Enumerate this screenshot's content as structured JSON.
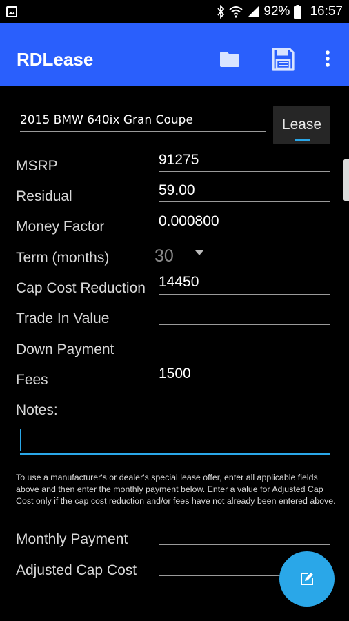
{
  "status_bar": {
    "battery": "92%",
    "time": "16:57",
    "icons": [
      "gallery-icon",
      "bluetooth-icon",
      "wifi-icon",
      "signal-icon",
      "battery-icon"
    ]
  },
  "app_bar": {
    "title": "RDLease",
    "color": "#2a5ffc",
    "actions": [
      "folder-icon",
      "save-icon",
      "more-vert-icon"
    ]
  },
  "vehicle": {
    "name": "2015 BMW 640ix Gran Coupe",
    "mode_button": "Lease"
  },
  "form": {
    "msrp": {
      "label": "MSRP",
      "value": "91275"
    },
    "residual": {
      "label": "Residual",
      "value": "59.00"
    },
    "money_factor": {
      "label": "Money Factor",
      "value": "0.000800"
    },
    "term": {
      "label": "Term (months)",
      "value": "30"
    },
    "cap_cost_reduction": {
      "label": "Cap Cost Reduction",
      "value": "14450"
    },
    "trade_in_value": {
      "label": "Trade In Value",
      "value": ""
    },
    "down_payment": {
      "label": "Down Payment",
      "value": ""
    },
    "fees": {
      "label": "Fees",
      "value": "1500"
    },
    "notes": {
      "label": "Notes:",
      "value": ""
    }
  },
  "help_text": "To use a manufacturer's or dealer's special lease offer, enter all applicable fields above and then enter the monthly payment below. Enter a value for Adjusted Cap Cost only if the cap cost reduction and/or fees have not already been entered above.",
  "special_offer": {
    "monthly_payment": {
      "label": "Monthly Payment",
      "value": ""
    },
    "adjusted_cap_cost": {
      "label": "Adjusted Cap Cost",
      "value": ""
    }
  },
  "fab": {
    "icon": "edit-icon",
    "color": "#2aa7e8"
  }
}
